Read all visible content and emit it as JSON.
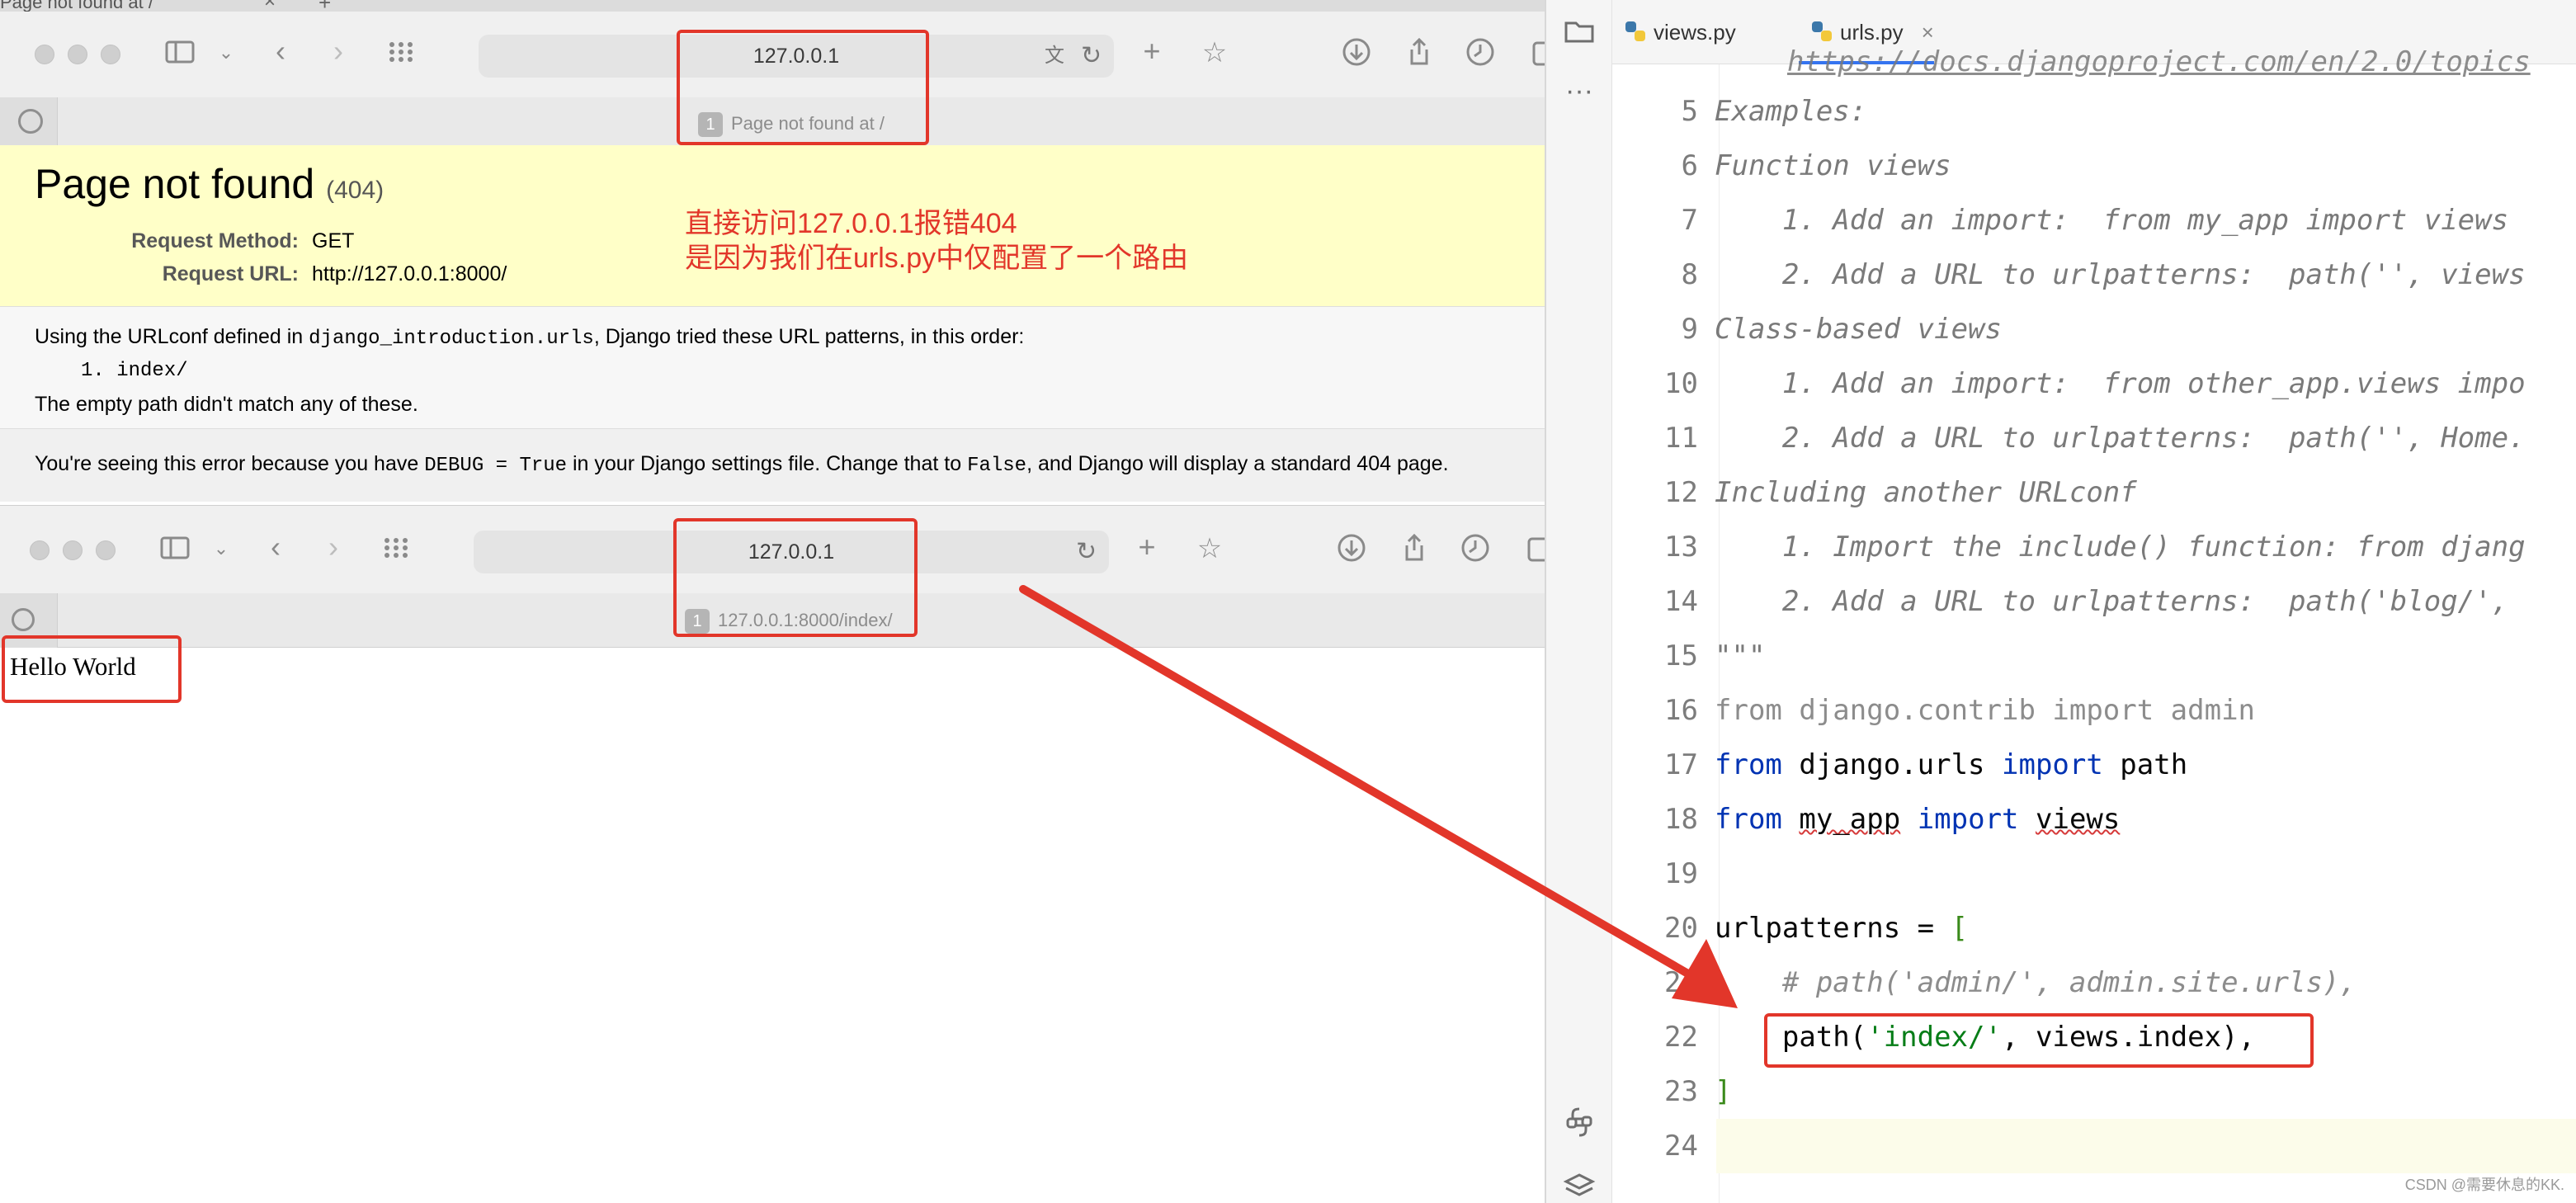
{
  "top_browser": {
    "partial_tab_title": "Page not found at /",
    "address": "127.0.0.1",
    "tab_number": "1",
    "tab_title": "Page not found at /"
  },
  "error_page": {
    "title": "Page not found",
    "status_code": "(404)",
    "request_method_label": "Request Method:",
    "request_method_value": "GET",
    "request_url_label": "Request URL:",
    "request_url_value": "http://127.0.0.1:8000/",
    "urlconf_prefix": "Using the URLconf defined in ",
    "urlconf_module": "django_introduction.urls",
    "urlconf_suffix": ", Django tried these URL patterns, in this order:",
    "pattern_item": "1.  index/",
    "empty_path_msg": "The empty path didn't match any of these.",
    "debug_prefix": "You're seeing this error because you have ",
    "debug_code": "DEBUG = True",
    "debug_middle": " in your Django settings file. Change that to ",
    "debug_false": "False",
    "debug_suffix": ", and Django will display a standard 404 page."
  },
  "annotation": {
    "line1": "直接访问127.0.0.1报错404",
    "line2": "是因为我们在urls.py中仅配置了一个路由"
  },
  "bottom_browser": {
    "address": "127.0.0.1",
    "tab_number": "1",
    "tab_title": "127.0.0.1:8000/index/",
    "page_text": "Hello World"
  },
  "ide": {
    "tabs": [
      {
        "label": "views.py"
      },
      {
        "label": "urls.py"
      }
    ],
    "line_numbers": [
      "5",
      "6",
      "7",
      "8",
      "9",
      "10",
      "11",
      "12",
      "13",
      "14",
      "15",
      "16",
      "17",
      "18",
      "19",
      "20",
      "21",
      "22",
      "23",
      "24"
    ],
    "code": {
      "l4_fragment": "https://docs.djangoproject.com/en/2.0/topics",
      "l5": "Examples:",
      "l6": "Function views",
      "l7": "    1. Add an import:  from my_app import views",
      "l8": "    2. Add a URL to urlpatterns:  path('', views",
      "l9": "Class-based views",
      "l10": "    1. Add an import:  from other_app.views impo",
      "l11": "    2. Add a URL to urlpatterns:  path('', Home.",
      "l12": "Including another URLconf",
      "l13": "    1. Import the include() function: from djang",
      "l14": "    2. Add a URL to urlpatterns:  path('blog/', ",
      "l15": "\"\"\"",
      "l16": "from django.contrib import admin",
      "l17_from": "from",
      "l17_mod": " django.urls ",
      "l17_import": "import",
      "l17_name": " path",
      "l18_from": "from",
      "l18_mod": "my_app",
      "l18_import": "import",
      "l18_name": "views",
      "l20_name": "urlpatterns = ",
      "l20_bracket": "[",
      "l21": "    # path('admin/', admin.site.urls),",
      "l22_pre": "    path(",
      "l22_str": "'index/'",
      "l22_post": ", views.index),",
      "l23": "]"
    },
    "watermark": "CSDN @需要休息的KK."
  },
  "colors": {
    "annotation_red": "#e2362a",
    "django_yellow": "#ffffc8",
    "keyword_blue": "#0033b3",
    "string_green": "#067d17",
    "tab_underline": "#3574f0"
  }
}
